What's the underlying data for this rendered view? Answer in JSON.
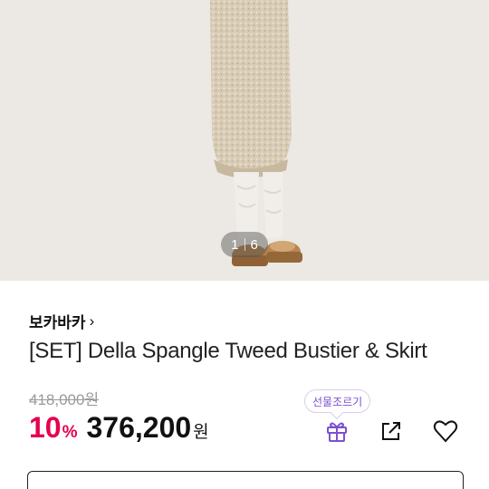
{
  "gallery": {
    "current": "1",
    "total": "6"
  },
  "brand": {
    "name": "보카바카",
    "chevron": "›"
  },
  "product": {
    "title": "[SET] Della Spangle Tweed Bustier & Skirt"
  },
  "pricing": {
    "original": "418,000원",
    "discount": "10",
    "discount_unit": "%",
    "sale_price": "376,200",
    "currency": "원"
  },
  "actions": {
    "gift_tooltip": "선물조르기",
    "gift_icon": "gift-icon",
    "share_icon": "share-icon",
    "like_icon": "heart-icon"
  },
  "colors": {
    "discount": "#e5004f",
    "gift_accent": "#7d4fd0"
  }
}
